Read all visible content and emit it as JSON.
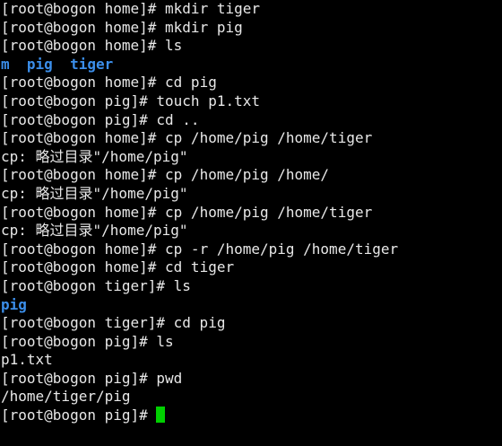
{
  "colors": {
    "background": "#000000",
    "text": "#e8e8e8",
    "directory": "#3b8eea",
    "cursor": "#00d000"
  },
  "lines": [
    {
      "type": "cmd",
      "prompt": "[root@bogon home]# ",
      "command": "mkdir tiger"
    },
    {
      "type": "cmd",
      "prompt": "[root@bogon home]# ",
      "command": "mkdir pig"
    },
    {
      "type": "cmd",
      "prompt": "[root@bogon home]# ",
      "command": "ls"
    },
    {
      "type": "dirs",
      "items": [
        "m",
        "pig",
        "tiger"
      ]
    },
    {
      "type": "cmd",
      "prompt": "[root@bogon home]# ",
      "command": "cd pig"
    },
    {
      "type": "cmd",
      "prompt": "[root@bogon pig]# ",
      "command": "touch p1.txt"
    },
    {
      "type": "cmd",
      "prompt": "[root@bogon pig]# ",
      "command": "cd .."
    },
    {
      "type": "cmd",
      "prompt": "[root@bogon home]# ",
      "command": "cp /home/pig /home/tiger"
    },
    {
      "type": "out",
      "text": "cp: 略过目录\"/home/pig\""
    },
    {
      "type": "cmd",
      "prompt": "[root@bogon home]# ",
      "command": "cp /home/pig /home/"
    },
    {
      "type": "out",
      "text": "cp: 略过目录\"/home/pig\""
    },
    {
      "type": "cmd",
      "prompt": "[root@bogon home]# ",
      "command": "cp /home/pig /home/tiger"
    },
    {
      "type": "out",
      "text": "cp: 略过目录\"/home/pig\""
    },
    {
      "type": "cmd",
      "prompt": "[root@bogon home]# ",
      "command": "cp -r /home/pig /home/tiger"
    },
    {
      "type": "cmd",
      "prompt": "[root@bogon home]# ",
      "command": "cd tiger"
    },
    {
      "type": "cmd",
      "prompt": "[root@bogon tiger]# ",
      "command": "ls"
    },
    {
      "type": "dirs",
      "items": [
        "pig"
      ]
    },
    {
      "type": "cmd",
      "prompt": "[root@bogon tiger]# ",
      "command": "cd pig"
    },
    {
      "type": "cmd",
      "prompt": "[root@bogon pig]# ",
      "command": "ls"
    },
    {
      "type": "out",
      "text": "p1.txt"
    },
    {
      "type": "cmd",
      "prompt": "[root@bogon pig]# ",
      "command": "pwd"
    },
    {
      "type": "out",
      "text": "/home/tiger/pig"
    }
  ],
  "current_prompt": "[root@bogon pig]# "
}
